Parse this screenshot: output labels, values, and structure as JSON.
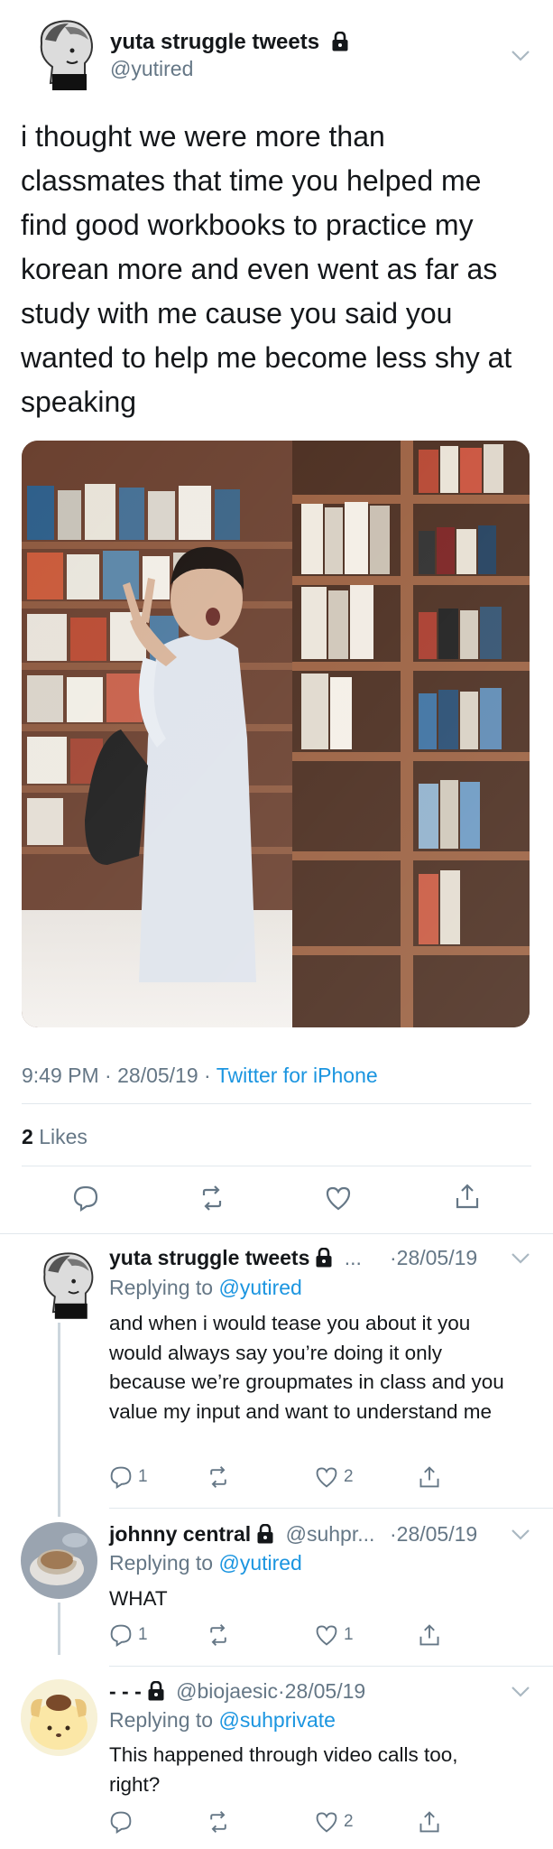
{
  "main_tweet": {
    "display_name": "yuta struggle tweets",
    "handle": "@yutired",
    "text": "i thought we were more than classmates that time you helped me find good workbooks to practice my korean more and even went as far as study with me cause you said you wanted to help me become less shy at speaking",
    "time": "9:49 PM",
    "date": "28/05/19",
    "separator": "·",
    "source": "Twitter for iPhone",
    "likes_count": "2",
    "likes_label": "Likes"
  },
  "replies": [
    {
      "display_name": "yuta struggle tweets",
      "handle_trunc": "...",
      "date": "·28/05/19",
      "replying_prefix": "Replying to",
      "replying_to": "@yutired",
      "text": "and when i would tease you about it you would always say you’re doing it only because we’re groupmates in class and you value my input and want to understand me",
      "reply_count": "1",
      "retweet_count": "",
      "like_count": "2"
    },
    {
      "display_name": "johnny central",
      "handle_trunc": "@suhpr...",
      "date": "·28/05/19",
      "replying_prefix": "Replying to",
      "replying_to": "@yutired",
      "text": "WHAT",
      "reply_count": "1",
      "retweet_count": "",
      "like_count": "1"
    },
    {
      "display_name": "- - -",
      "handle_trunc": "@biojaesic",
      "date": "·28/05/19",
      "replying_prefix": "Replying to",
      "replying_to": "@suhprivate",
      "text": "This happened through video calls too, right?",
      "reply_count": "",
      "retweet_count": "",
      "like_count": "2"
    }
  ],
  "icons": {
    "lock": "lock-icon",
    "chevron": "chevron-down-icon",
    "reply": "reply-icon",
    "retweet": "retweet-icon",
    "like": "heart-icon",
    "share": "share-icon"
  },
  "colors": {
    "link": "#1b95e0",
    "secondary": "#657786",
    "divider": "#e1e8ed"
  }
}
